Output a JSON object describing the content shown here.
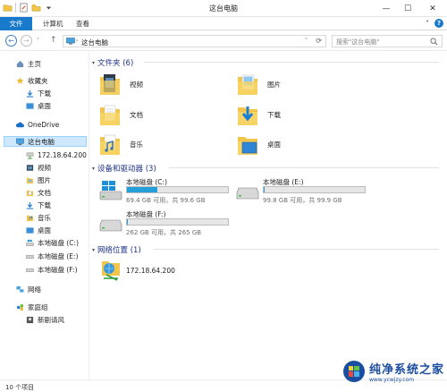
{
  "window": {
    "title": "这台电脑",
    "minimize": "—",
    "maximize": "☐",
    "close": "✕"
  },
  "ribbon": {
    "tabs": [
      "文件",
      "计算机",
      "查看"
    ],
    "collapse": "˅",
    "help": "?"
  },
  "nav": {
    "back": "←",
    "forward": "→",
    "history": "˅",
    "up": "↑",
    "address_arrow": "›",
    "address_crumb": "这台电脑",
    "address_dropdown": "˅",
    "refresh": "⟳",
    "search_placeholder": "搜索\"这台电脑\""
  },
  "sidebar": {
    "home": "主页",
    "favorites": "收藏夹",
    "downloads": "下载",
    "desktop": "桌面",
    "onedrive": "OneDrive",
    "thispc": "这台电脑",
    "pc_items": [
      "172.18.64.200",
      "视频",
      "图片",
      "文档",
      "下载",
      "音乐",
      "桌面",
      "本地磁盘 (C:)",
      "本地磁盘 (E:)",
      "本地磁盘 (F:)"
    ],
    "network": "网络",
    "homegroup": "家庭组",
    "homegroup_child": "新剧请风"
  },
  "content": {
    "folders_header": "文件夹 (6)",
    "folders": [
      "视频",
      "图片",
      "文档",
      "下载",
      "音乐",
      "桌面"
    ],
    "drives_header": "设备和驱动器 (3)",
    "drives": [
      {
        "name": "本地磁盘 (C:)",
        "size": "69.4 GB 可用，共 99.6 GB",
        "used_fraction": 0.3
      },
      {
        "name": "本地磁盘 (E:)",
        "size": "99.8 GB 可用，共 99.9 GB",
        "used_fraction": 0.002
      },
      {
        "name": "本地磁盘 (F:)",
        "size": "262 GB 可用，共 265 GB",
        "used_fraction": 0.012
      }
    ],
    "network_header": "网络位置 (1)",
    "network_items": [
      "172.18.64.200"
    ]
  },
  "status": {
    "item_count": "10 个项目"
  },
  "watermark": {
    "name": "纯净系统之家",
    "url": "www.ycwjzy.com"
  },
  "colors": {
    "accent": "#1979ca",
    "group_header": "#1e3287",
    "drive_fill": "#26a0da",
    "folder_yellow": "#f3c54a"
  }
}
